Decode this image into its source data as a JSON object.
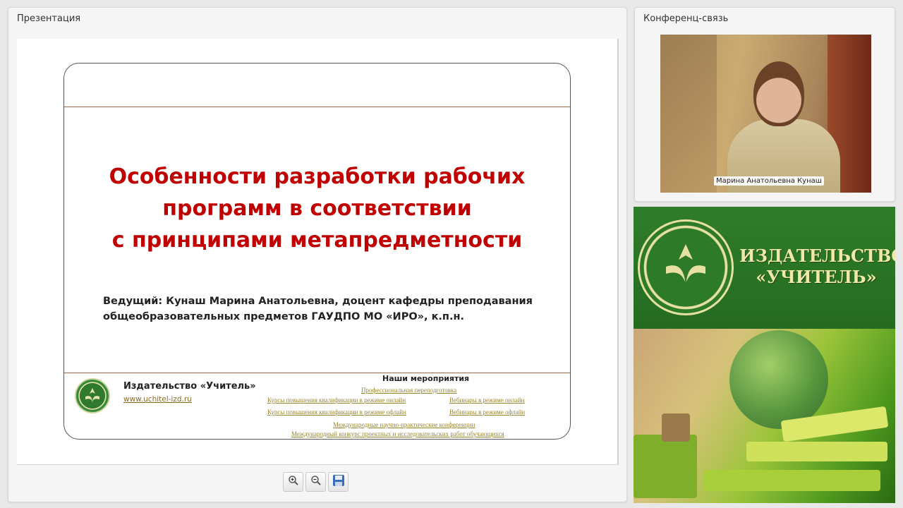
{
  "presentation": {
    "title": "Презентация",
    "slide": {
      "title_lines": [
        "Особенности разработки рабочих",
        "программ в соответствии",
        "с принципами метапредметности"
      ],
      "presenter_lines": [
        "Ведущий: Кунаш Марина Анатольевна, доцент кафедры преподавания",
        "общеобразовательных предметов ГАУДПО МО «ИРО», к.п.н."
      ],
      "publisher_name": "Издательство «Учитель»",
      "publisher_url": "www.uchitel-izd.ru",
      "events_title": "Наши мероприятия",
      "events": [
        "Профессиональная переподготовка",
        "Курсы повышения квалификации в режиме онлайн",
        "Вебинары в режиме онлайн",
        "Курсы повышения квалификации в режиме офлайн",
        "Вебинары в режиме офлайн",
        "Международные научно-практические конференции",
        "Международный конкурс проектных и исследовательских работ обучающихся"
      ]
    },
    "toolbar": {
      "zoom_in_icon": "zoom-in-icon",
      "zoom_out_icon": "zoom-out-icon",
      "save_icon": "save-icon"
    }
  },
  "conference": {
    "title": "Конференц-связь",
    "participant_name": "Марина Анатольевна Кунаш"
  },
  "ad": {
    "line1": "ИЗДАТЕЛЬСТВО",
    "line2": "«УЧИТЕЛЬ»"
  },
  "colors": {
    "slide_title": "#c00000",
    "brand_green": "#2f7d2a",
    "brand_gold": "#f1e8a8"
  }
}
